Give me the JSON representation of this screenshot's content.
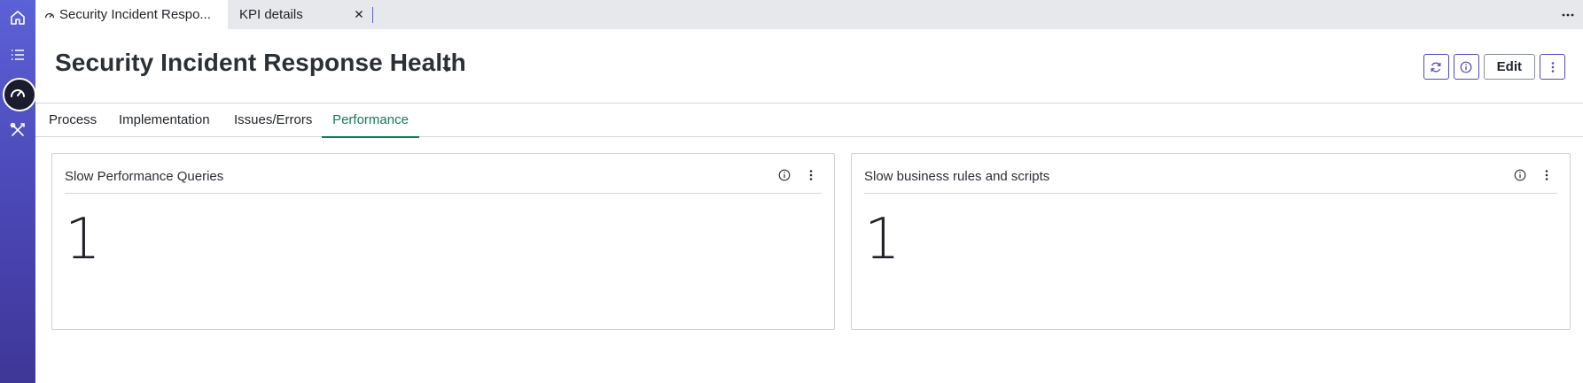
{
  "rail": {
    "items": [
      {
        "icon": "home-icon"
      },
      {
        "icon": "list-icon"
      },
      {
        "icon": "dashboard-gauge-icon",
        "active": true
      },
      {
        "icon": "tools-icon"
      }
    ]
  },
  "tabs": [
    {
      "label": "Security Incident Respo...",
      "icon": "gauge-icon",
      "active": true
    },
    {
      "label": "KPI details",
      "closable": true
    }
  ],
  "header": {
    "title": "Security Incident Response Health",
    "edit_label": "Edit",
    "actions": [
      "refresh-icon",
      "info-icon",
      "more-vertical-icon"
    ]
  },
  "dashboard_tabs": [
    {
      "label": "Process"
    },
    {
      "label": "Implementation"
    },
    {
      "label": "Issues/Errors"
    },
    {
      "label": "Performance",
      "selected": true
    }
  ],
  "cards": [
    {
      "title": "Slow Performance Queries",
      "value": "1"
    },
    {
      "title": "Slow business rules and scripts",
      "value": "1"
    }
  ],
  "colors": {
    "accent": "#4f4cc0",
    "selected_tab": "#0f7a55",
    "rail_top": "#5b61d6",
    "rail_bottom": "#3e3797"
  }
}
